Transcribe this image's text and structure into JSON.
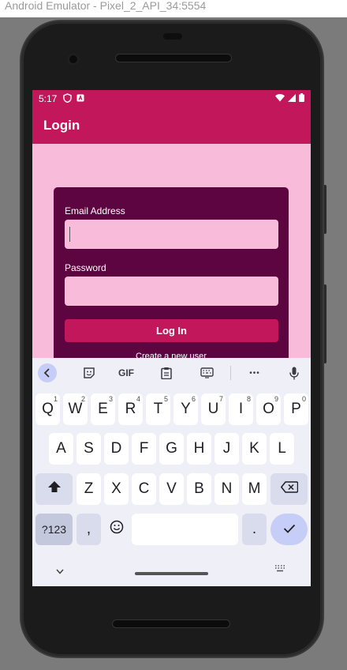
{
  "window": {
    "title": "Android Emulator - Pixel_2_API_34:5554"
  },
  "status_bar": {
    "time": "5:17",
    "icons": [
      "shield-icon",
      "notification-a-icon",
      "wifi-icon",
      "signal-icon",
      "battery-icon"
    ]
  },
  "app_bar": {
    "title": "Login"
  },
  "form": {
    "email_label": "Email Address",
    "email_value": "",
    "password_label": "Password",
    "password_value": "",
    "login_label": "Log In",
    "create_account_label": "Create a new user"
  },
  "keyboard": {
    "toolbar": {
      "gif_label": "GIF",
      "more_label": "•••"
    },
    "row1": [
      {
        "label": "Q",
        "hint": "1"
      },
      {
        "label": "W",
        "hint": "2"
      },
      {
        "label": "E",
        "hint": "3"
      },
      {
        "label": "R",
        "hint": "4"
      },
      {
        "label": "T",
        "hint": "5"
      },
      {
        "label": "Y",
        "hint": "6"
      },
      {
        "label": "U",
        "hint": "7"
      },
      {
        "label": "I",
        "hint": "8"
      },
      {
        "label": "O",
        "hint": "9"
      },
      {
        "label": "P",
        "hint": "0"
      }
    ],
    "row2": [
      "A",
      "S",
      "D",
      "F",
      "G",
      "H",
      "J",
      "K",
      "L"
    ],
    "row3": [
      "Z",
      "X",
      "C",
      "V",
      "B",
      "N",
      "M"
    ],
    "row4": {
      "symbols_label": "?123",
      "comma_label": ",",
      "period_label": "."
    }
  },
  "colors": {
    "primary": "#c2185b",
    "background": "#f8bbd9",
    "card": "#5d0540"
  }
}
